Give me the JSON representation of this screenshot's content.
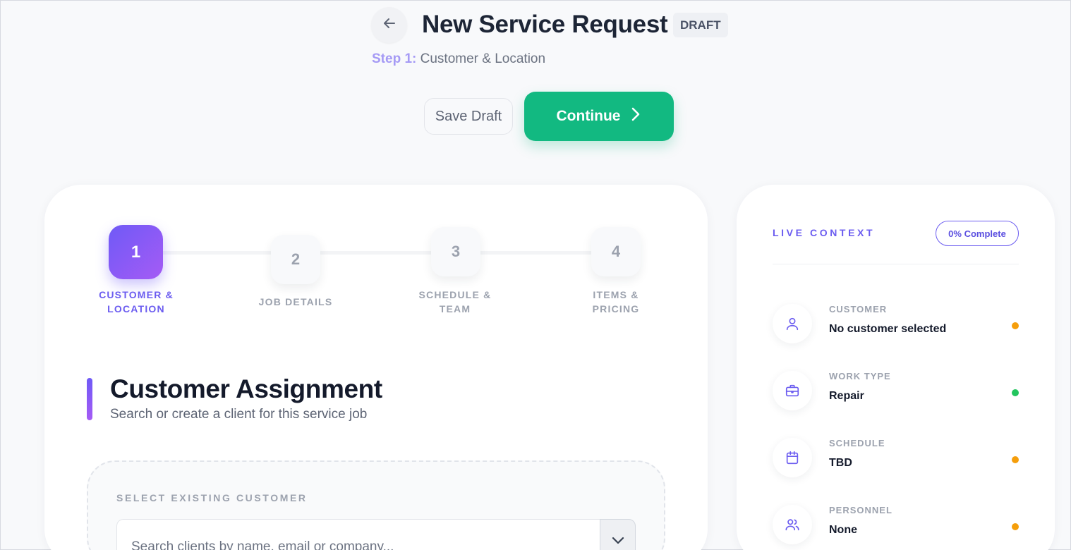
{
  "header": {
    "title": "New Service Request",
    "badge": "DRAFT",
    "step_prefix": "Step 1:",
    "step_name": "Customer & Location",
    "save_draft_label": "Save Draft",
    "continue_label": "Continue"
  },
  "stepper": {
    "steps": [
      {
        "number": "1",
        "label": "CUSTOMER & LOCATION",
        "active": true
      },
      {
        "number": "2",
        "label": "JOB DETAILS",
        "active": false
      },
      {
        "number": "3",
        "label": "SCHEDULE & TEAM",
        "active": false
      },
      {
        "number": "4",
        "label": "ITEMS & PRICING",
        "active": false
      }
    ]
  },
  "section": {
    "title": "Customer Assignment",
    "subtitle": "Search or create a client for this service job"
  },
  "customer_select": {
    "label": "SELECT EXISTING CUSTOMER",
    "placeholder": "Search clients by name, email or company..."
  },
  "context": {
    "heading": "LIVE CONTEXT",
    "completion": "0% Complete",
    "items": [
      {
        "label": "CUSTOMER",
        "value": "No customer selected",
        "icon": "user-icon",
        "status_color": "#f59e0b"
      },
      {
        "label": "WORK TYPE",
        "value": "Repair",
        "icon": "briefcase-icon",
        "status_color": "#22c55e"
      },
      {
        "label": "SCHEDULE",
        "value": "TBD",
        "icon": "calendar-icon",
        "status_color": "#f59e0b"
      },
      {
        "label": "PERSONNEL",
        "value": "None",
        "icon": "users-icon",
        "status_color": "#f59e0b"
      }
    ]
  },
  "colors": {
    "accent": "#6b5cf0",
    "primary_button": "#12b981",
    "pending": "#f59e0b",
    "ok": "#22c55e"
  }
}
